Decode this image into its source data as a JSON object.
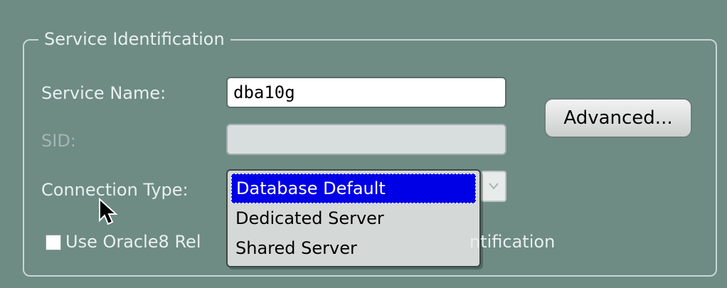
{
  "section": {
    "title": "Service Identification"
  },
  "fields": {
    "service_name_label": "Service Name:",
    "service_name_value": "dba10g",
    "sid_label": "SID:",
    "sid_value": "",
    "connection_type_label": "Connection Type:"
  },
  "buttons": {
    "advanced_label": "Advanced..."
  },
  "connection_type_dropdown": {
    "options": [
      "Database Default",
      "Dedicated Server",
      "Shared Server"
    ],
    "selected_index": 0
  },
  "checkbox": {
    "label_visible_left": "Use Oracle8 Rel",
    "label_visible_right": "ntification",
    "checked": false
  },
  "colors": {
    "background": "#6e8b84",
    "selection": "#0000e6"
  },
  "icons": {
    "dropdown": "chevron-down-icon",
    "pointer": "mouse-cursor-icon"
  }
}
